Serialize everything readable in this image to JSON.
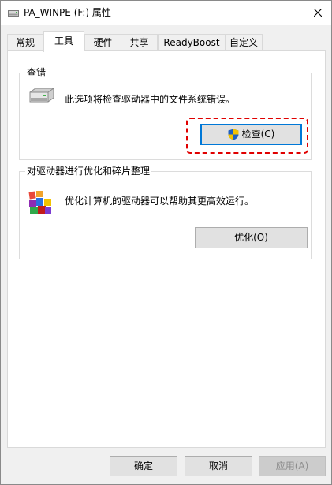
{
  "window": {
    "title": "PA_WINPE (F:) 属性"
  },
  "tabs": [
    {
      "label": "常规",
      "selected": false
    },
    {
      "label": "工具",
      "selected": true
    },
    {
      "label": "硬件",
      "selected": false
    },
    {
      "label": "共享",
      "selected": false
    },
    {
      "label": "ReadyBoost",
      "selected": false
    },
    {
      "label": "自定义",
      "selected": false
    }
  ],
  "error_checking": {
    "title": "查错",
    "description": "此选项将检查驱动器中的文件系统错误。",
    "check_button": "检查(C)",
    "icon": "drive-icon"
  },
  "optimize": {
    "title": "对驱动器进行优化和碎片整理",
    "description": "优化计算机的驱动器可以帮助其更高效运行。",
    "optimize_button": "优化(O)",
    "icon": "defrag-icon"
  },
  "footer": {
    "ok": "确定",
    "cancel": "取消",
    "apply": "应用(A)"
  },
  "colors": {
    "focus_blue": "#0078d7",
    "annotation_red": "#e00000",
    "shield_blue": "#1f5fbf",
    "shield_yellow": "#f2c200"
  }
}
